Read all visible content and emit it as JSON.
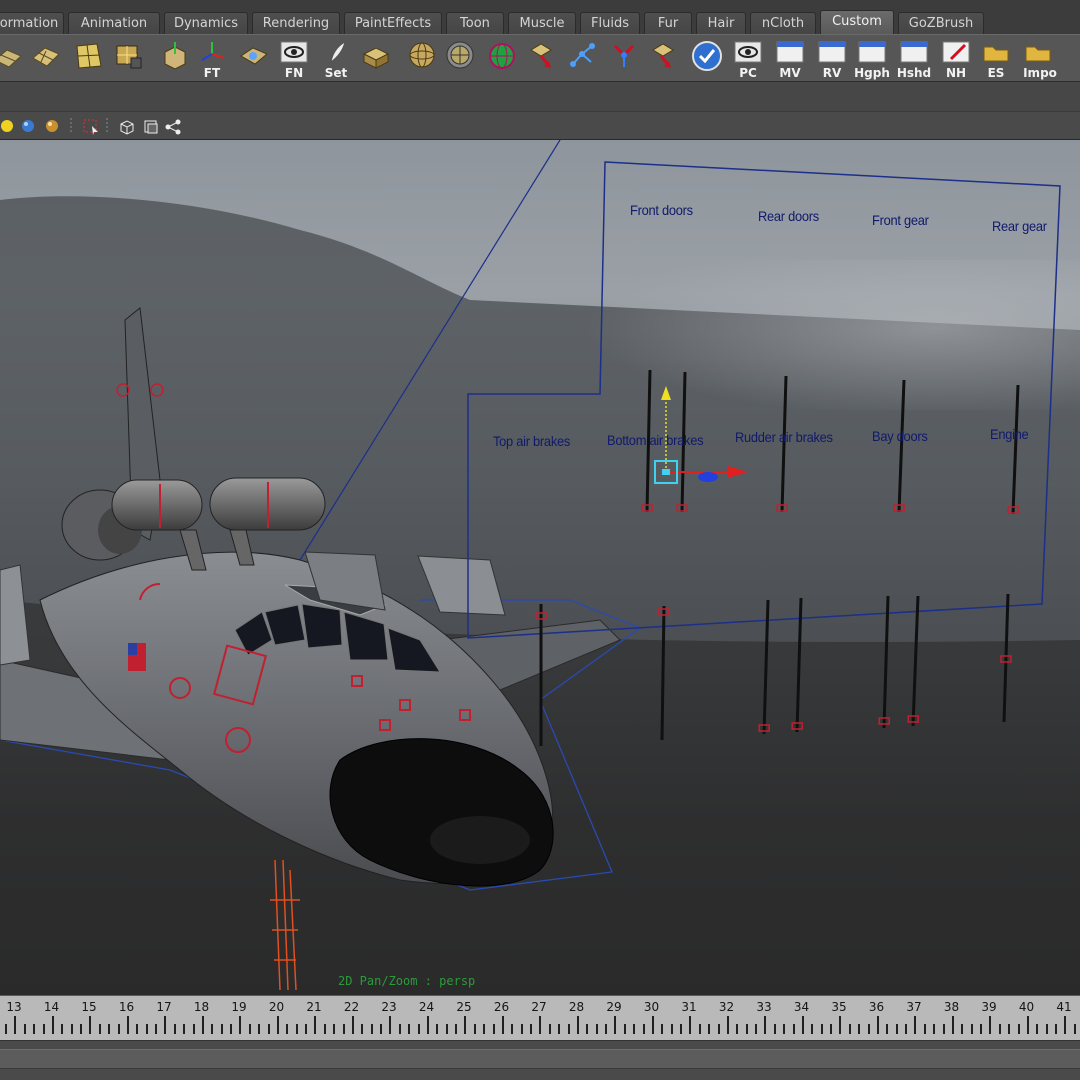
{
  "shelf_tabs": [
    {
      "label": "ormation",
      "active": false
    },
    {
      "label": "Animation",
      "active": false
    },
    {
      "label": "Dynamics",
      "active": false
    },
    {
      "label": "Rendering",
      "active": false
    },
    {
      "label": "PaintEffects",
      "active": false
    },
    {
      "label": "Toon",
      "active": false
    },
    {
      "label": "Muscle",
      "active": false
    },
    {
      "label": "Fluids",
      "active": false
    },
    {
      "label": "Fur",
      "active": false
    },
    {
      "label": "Hair",
      "active": false
    },
    {
      "label": "nCloth",
      "active": false
    },
    {
      "label": "Custom",
      "active": true
    },
    {
      "label": "GoZBrush",
      "active": false
    }
  ],
  "shelf_buttons": [
    {
      "icon": "nurbs-plane-icon",
      "label": ""
    },
    {
      "icon": "poly-plane-icon",
      "label": ""
    },
    {
      "icon": "uv-grid-icon",
      "label": ""
    },
    {
      "icon": "lattice-icon",
      "label": ""
    },
    {
      "icon": "cube-move-icon",
      "label": ""
    },
    {
      "icon": "freeze-transform-icon",
      "label": "FT"
    },
    {
      "icon": "component-icon",
      "label": ""
    },
    {
      "icon": "eye-icon",
      "label": "FN"
    },
    {
      "icon": "feather-icon",
      "label": "Set"
    },
    {
      "icon": "box-folder-icon",
      "label": ""
    },
    {
      "icon": "sphere-mesh-icon",
      "label": ""
    },
    {
      "icon": "grid-sphere-icon",
      "label": ""
    },
    {
      "icon": "globe-icon",
      "label": ""
    },
    {
      "icon": "arrow-down-icon",
      "label": ""
    },
    {
      "icon": "joint-icon",
      "label": ""
    },
    {
      "icon": "ik-handle-icon",
      "label": ""
    },
    {
      "icon": "arrow-down-red-icon",
      "label": ""
    },
    {
      "icon": "check-circle-icon",
      "label": ""
    },
    {
      "icon": "eye-panel-icon",
      "label": "PC"
    },
    {
      "icon": "panel-icon",
      "label": "MV"
    },
    {
      "icon": "panel-icon",
      "label": "RV"
    },
    {
      "icon": "panel-icon",
      "label": "Hgph"
    },
    {
      "icon": "panel-icon",
      "label": "Hshd"
    },
    {
      "icon": "pencil-icon",
      "label": "NH"
    },
    {
      "icon": "folder-icon",
      "label": "ES"
    },
    {
      "icon": "folder-icon",
      "label": "Impo"
    }
  ],
  "viewport_toolbar": {
    "icons": [
      "light-yellow-icon",
      "sphere-blue-icon",
      "sphere-gold-icon",
      "separator-icon",
      "select-region-icon",
      "separator-icon",
      "wireframe-cube-icon",
      "isolate-icon",
      "share-nodes-icon"
    ]
  },
  "control_panel": {
    "labels": [
      "Front doors",
      "Rear doors",
      "Front gear",
      "Rear gear",
      "Top air brakes",
      "Bottom air brakes",
      "Rudder air brakes",
      "Bay doors",
      "Engine"
    ]
  },
  "viewport_status": "2D Pan/Zoom : persp",
  "timeline": {
    "frames": [
      "13",
      "14",
      "15",
      "16",
      "17",
      "18",
      "19",
      "20",
      "21",
      "22",
      "23",
      "24",
      "25",
      "26",
      "27",
      "28",
      "29",
      "30",
      "31",
      "32",
      "33",
      "34",
      "35",
      "36",
      "37",
      "38",
      "39",
      "40",
      "41"
    ]
  },
  "colors": {
    "ui_dark": "#3c3c3c",
    "active_tab": "#6b6b6b",
    "rig_frame_blue": "#1c2f8a",
    "label_navy": "#101a6a",
    "control_red": "#c02030",
    "status_green": "#2c9a3a"
  }
}
